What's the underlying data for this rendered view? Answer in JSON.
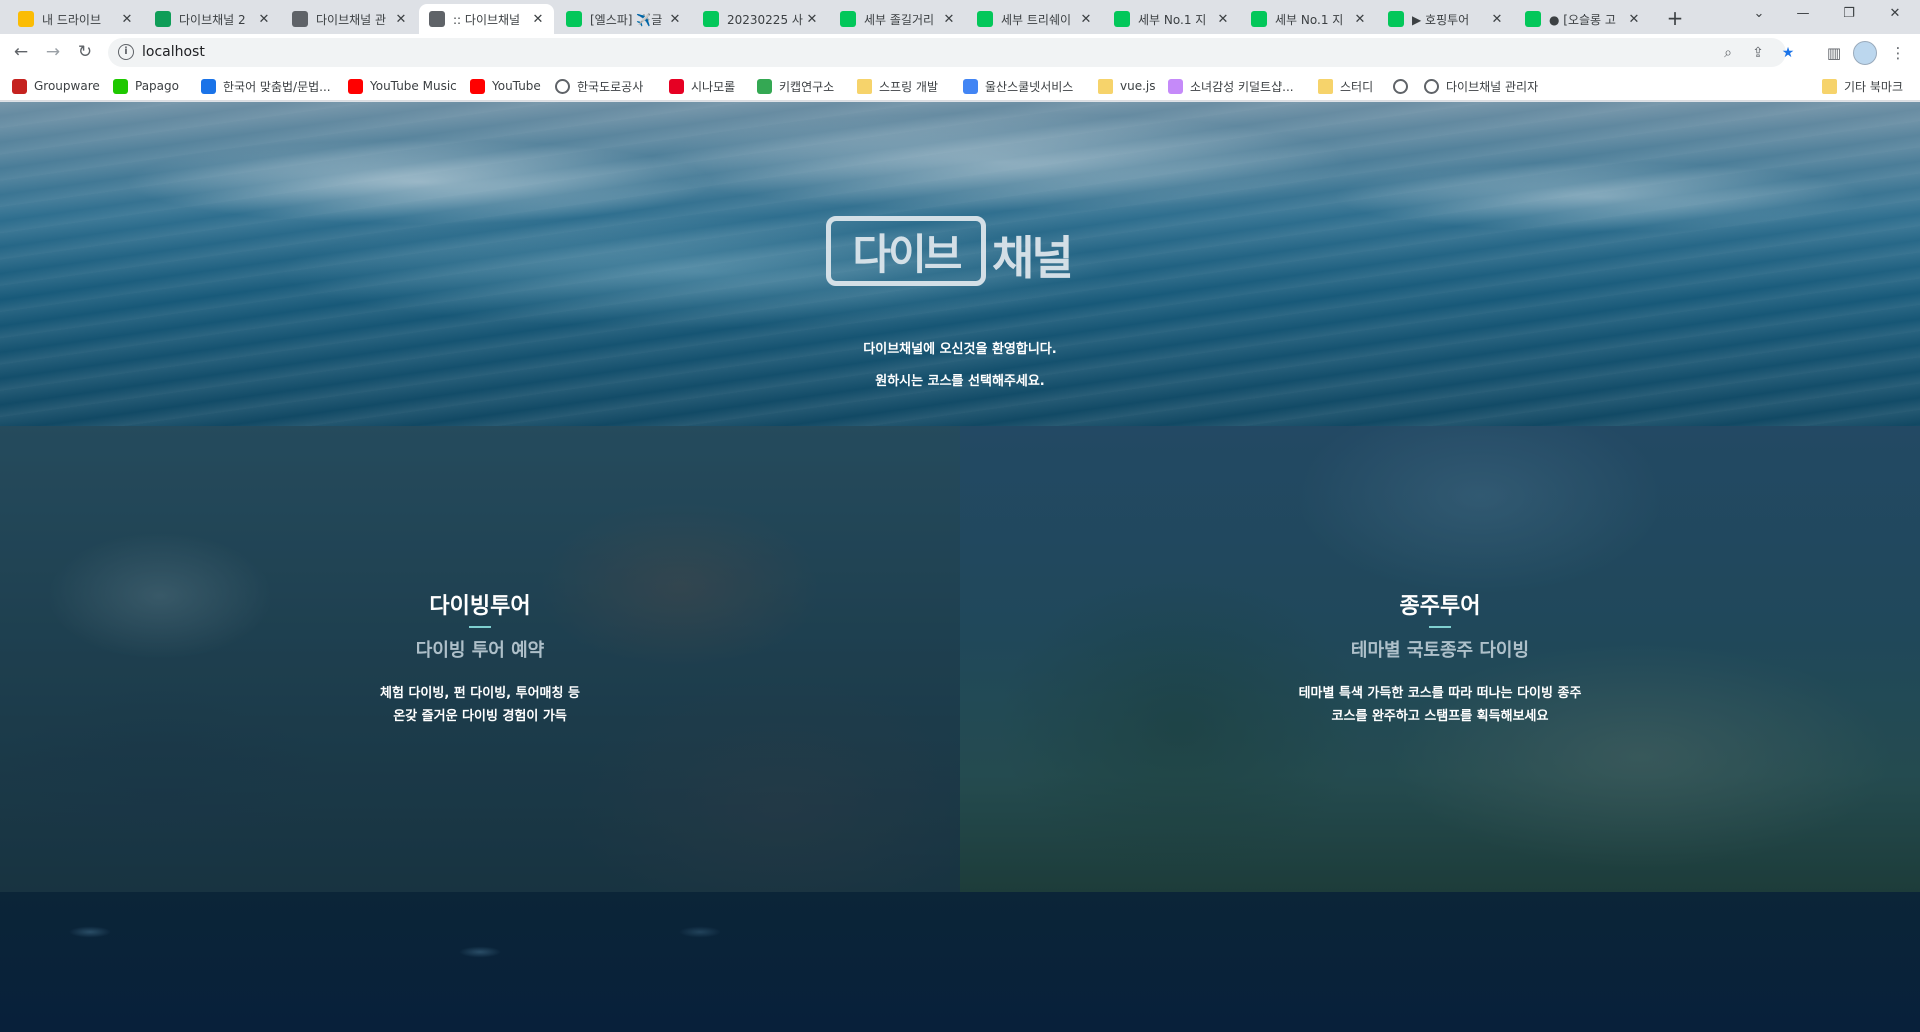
{
  "browser": {
    "tabs": [
      {
        "title": "내 드라이브",
        "icon": "google-drive-icon",
        "color": "#fbbc04"
      },
      {
        "title": "다이브채널 2",
        "icon": "sheets-icon",
        "color": "#0f9d58"
      },
      {
        "title": "다이브채널 관",
        "icon": "globe-icon",
        "color": "#5f6368"
      },
      {
        "title": ":: 다이브채널",
        "icon": "globe-icon",
        "color": "#5f6368",
        "active": true
      },
      {
        "title": "[엘스파] ✈️글",
        "icon": "naver-blog-icon",
        "color": "#03c75a"
      },
      {
        "title": "20230225 사",
        "icon": "naver-blog-icon",
        "color": "#03c75a"
      },
      {
        "title": "세부 졸길거리",
        "icon": "naver-blog-icon",
        "color": "#03c75a"
      },
      {
        "title": "세부 트리쉐이",
        "icon": "naver-icon",
        "color": "#03c75a"
      },
      {
        "title": "세부 No.1 지",
        "icon": "naver-blog-icon",
        "color": "#03c75a"
      },
      {
        "title": "세부 No.1 지",
        "icon": "naver-blog-icon",
        "color": "#03c75a"
      },
      {
        "title": "▶ 호핑투어",
        "icon": "naver-blog-icon",
        "color": "#03c75a"
      },
      {
        "title": "● [오슬롱 고",
        "icon": "naver-blog-icon",
        "color": "#03c75a"
      }
    ],
    "address": "localhost",
    "bookmarks": [
      {
        "label": "Groupware",
        "icon": "groupware-icon",
        "color": "#c5221f"
      },
      {
        "label": "Papago",
        "icon": "papago-icon",
        "color": "#1ec800"
      },
      {
        "label": "한국어 맞춤법/문법...",
        "icon": "spellcheck-icon",
        "color": "#1a73e8"
      },
      {
        "label": "YouTube Music",
        "icon": "youtube-music-icon",
        "color": "#ff0000"
      },
      {
        "label": "YouTube",
        "icon": "youtube-icon",
        "color": "#ff0000"
      },
      {
        "label": "한국도로공사",
        "icon": "globe-icon",
        "color": "#5f6368"
      },
      {
        "label": "시나모롤",
        "icon": "pinterest-icon",
        "color": "#e60023"
      },
      {
        "label": "키캡연구소",
        "icon": "keycap-icon",
        "color": "#34a853"
      },
      {
        "label": "스프링 개발",
        "icon": "folder-icon",
        "color": "#f6d36b"
      },
      {
        "label": "울산스쿨넷서비스",
        "icon": "school-icon",
        "color": "#4285f4"
      },
      {
        "label": "vue.js",
        "icon": "folder-icon",
        "color": "#f6d36b"
      },
      {
        "label": "소녀감성 키덜트샵...",
        "icon": "shop-icon",
        "color": "#c58af9"
      },
      {
        "label": "스터디",
        "icon": "folder-icon",
        "color": "#f6d36b"
      },
      {
        "label": "",
        "icon": "globe-icon",
        "color": "#5f6368"
      },
      {
        "label": "다이브채널 관리자",
        "icon": "globe-icon",
        "color": "#5f6368"
      }
    ],
    "other_bookmarks": "기타 북마크"
  },
  "hero": {
    "logo_boxed": "다이브",
    "logo_rest": "채널",
    "welcome_line1": "다이브채널에 오신것을 환영합니다.",
    "welcome_line2": "원하시는 코스를 선택해주세요."
  },
  "panels": [
    {
      "title": "다이빙투어",
      "subtitle": "다이빙 투어 예약",
      "desc_line1": "체험 다이빙, 펀 다이빙, 투어매칭 등",
      "desc_line2": "온갖 즐거운 다이빙 경험이 가득"
    },
    {
      "title": "종주투어",
      "subtitle": "테마별 국토종주 다이빙",
      "desc_line1": "테마별 특색 가득한 코스를 따라 떠나는 다이빙 종주",
      "desc_line2": "코스를 완주하고 스탬프를 획득해보세요"
    }
  ]
}
